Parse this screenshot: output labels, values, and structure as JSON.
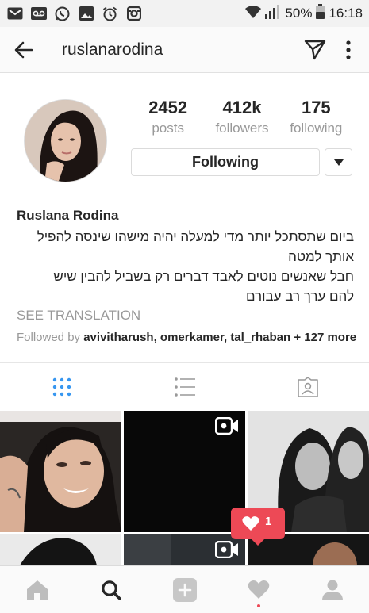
{
  "status_bar": {
    "battery": "50%",
    "time": "16:18",
    "icons": [
      "gmail-icon",
      "voicemail-icon",
      "whatsapp-icon",
      "gallery-icon",
      "alarm-icon",
      "instagram-icon",
      "wifi-icon",
      "signal-icon",
      "battery-icon"
    ]
  },
  "header": {
    "username": "ruslanarodina"
  },
  "profile": {
    "stats": [
      {
        "value": "2452",
        "label": "posts"
      },
      {
        "value": "412k",
        "label": "followers"
      },
      {
        "value": "175",
        "label": "following"
      }
    ],
    "follow_button": "Following"
  },
  "bio": {
    "name": "Ruslana Rodina",
    "lines": [
      "ביום שתסתכל יותר מדי למעלה יהיה מישהו שינסה להפיל",
      "אותך למטה",
      "חבל שאנשים נוטים לאבד דברים רק בשביל להבין שיש",
      "להם ערך רב עבורם"
    ],
    "see_translation": "SEE TRANSLATION",
    "followed_by_prefix": "Followed by",
    "followed_by_users": "avivitharush, omerkamer, tal_rhaban",
    "followed_by_more": "+ 127 more"
  },
  "notification": {
    "like_count": "1"
  },
  "colors": {
    "accent_red": "#ed4956",
    "tab_active": "#3897f0",
    "muted_text": "#999999"
  }
}
